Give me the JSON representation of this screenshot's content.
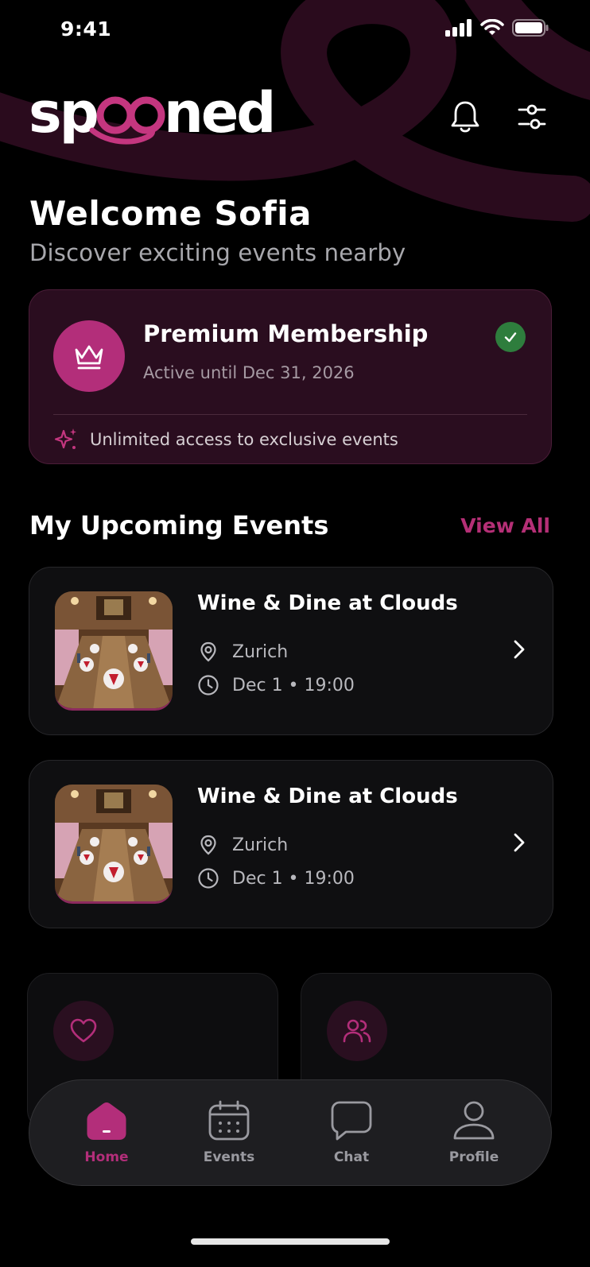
{
  "status_bar": {
    "time": "9:41"
  },
  "header": {
    "logo_text": "spooned"
  },
  "welcome": {
    "title": "Welcome Sofia",
    "subtitle": "Discover exciting events nearby"
  },
  "membership": {
    "title": "Premium Membership",
    "subtitle": "Active until Dec 31, 2026",
    "perk": "Unlimited access to exclusive events",
    "status": "active"
  },
  "upcoming": {
    "title": "My Upcoming Events",
    "view_all": "View All",
    "events": [
      {
        "title": "Wine & Dine at Clouds",
        "location": "Zurich",
        "datetime": "Dec 1 • 19:00"
      },
      {
        "title": "Wine & Dine at Clouds",
        "location": "Zurich",
        "datetime": "Dec 1 • 19:00"
      }
    ]
  },
  "quick_actions": [
    {
      "icon": "heart-icon"
    },
    {
      "icon": "users-icon"
    }
  ],
  "tab_bar": {
    "tabs": [
      {
        "label": "Home",
        "icon": "home-icon",
        "active": true
      },
      {
        "label": "Events",
        "icon": "calendar-icon",
        "active": false
      },
      {
        "label": "Chat",
        "icon": "chat-icon",
        "active": false
      },
      {
        "label": "Profile",
        "icon": "profile-icon",
        "active": false
      }
    ]
  },
  "colors": {
    "accent": "#b32e7a",
    "background": "#000000",
    "card": "#0f0f11",
    "premium_card": "#2a0d1f",
    "success": "#2e7d3d"
  }
}
